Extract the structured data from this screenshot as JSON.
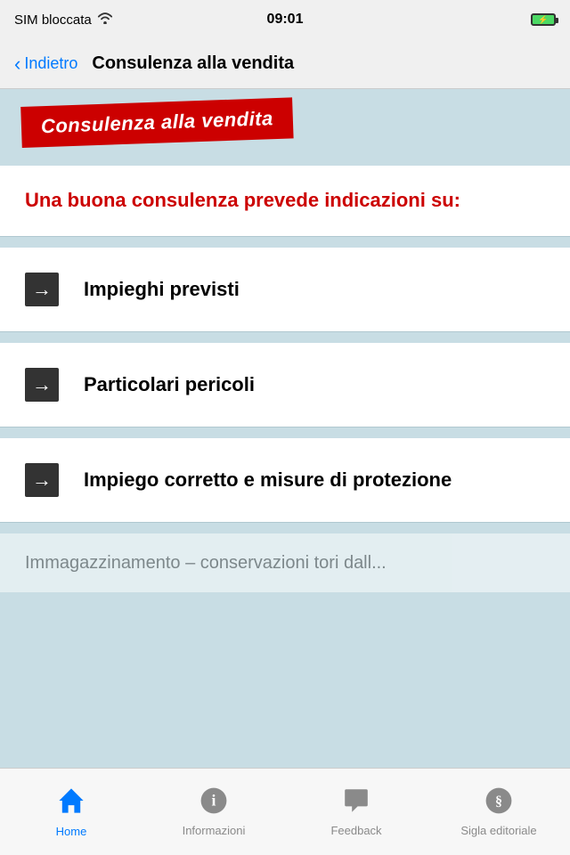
{
  "statusBar": {
    "carrier": "SIM bloccata",
    "wifi": "wifi",
    "time": "09:01",
    "battery": "+"
  },
  "navBar": {
    "backLabel": "Indietro",
    "title": "Consulenza alla vendita"
  },
  "banner": {
    "label": "Consulenza alla vendita"
  },
  "description": {
    "text": "Una buona consulenza prevede indicazioni su:"
  },
  "listItems": [
    {
      "id": "impieghi",
      "label": "Impieghi previsti"
    },
    {
      "id": "pericoli",
      "label": "Particolari pericoli"
    },
    {
      "id": "impiego-corretto",
      "label": "Impiego corretto e misure di protezione"
    }
  ],
  "blurredText": "Immagazzinamento – conservazioni tori dall...",
  "tabBar": {
    "items": [
      {
        "id": "home",
        "label": "Home",
        "active": true
      },
      {
        "id": "informazioni",
        "label": "Informazioni",
        "active": false
      },
      {
        "id": "feedback",
        "label": "Feedback",
        "active": false
      },
      {
        "id": "sigla-editoriale",
        "label": "Sigla editoriale",
        "active": false
      }
    ]
  }
}
